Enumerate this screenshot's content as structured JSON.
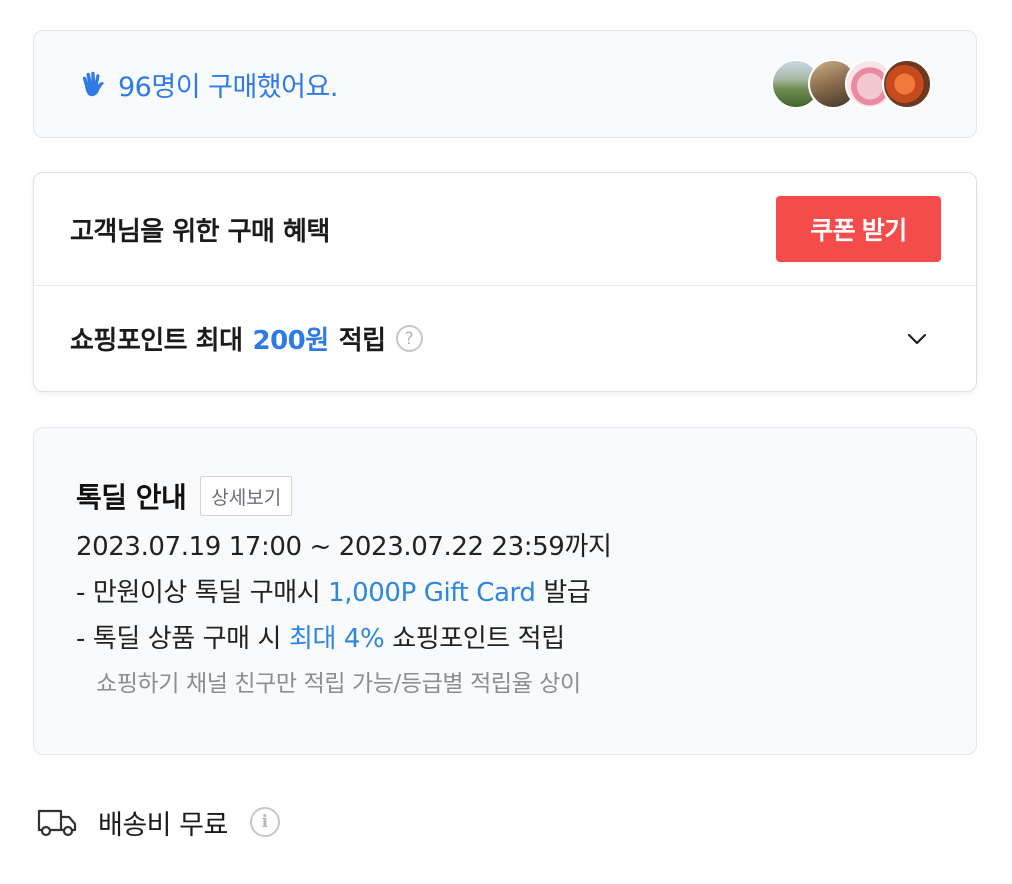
{
  "buyers": {
    "text": "96명이 구매했어요.",
    "avatar_count": 4,
    "accent_color": "#2f7be5"
  },
  "benefit": {
    "title": "고객님을 위한 구매 혜택",
    "coupon_button": "쿠폰 받기",
    "coupon_color": "#f44b4b",
    "points_prefix": "쇼핑포인트 최대",
    "points_amount": "200원",
    "points_suffix": "적립",
    "help_glyph": "?"
  },
  "deal": {
    "title": "톡딜 안내",
    "detail_button": "상세보기",
    "period": "2023.07.19 17:00 ~ 2023.07.22 23:59까지",
    "line1_prefix": "- 만원이상 톡딜 구매시",
    "line1_highlight": "1,000P Gift Card",
    "line1_suffix": "발급",
    "line2_prefix": "- 톡딜 상품 구매 시",
    "line2_highlight": "최대 4%",
    "line2_suffix": "쇼핑포인트 적립",
    "note": "쇼핑하기 채널 친구만 적립 가능/등급별 적립율 상이"
  },
  "shipping": {
    "text": "배송비 무료",
    "info_glyph": "i"
  }
}
